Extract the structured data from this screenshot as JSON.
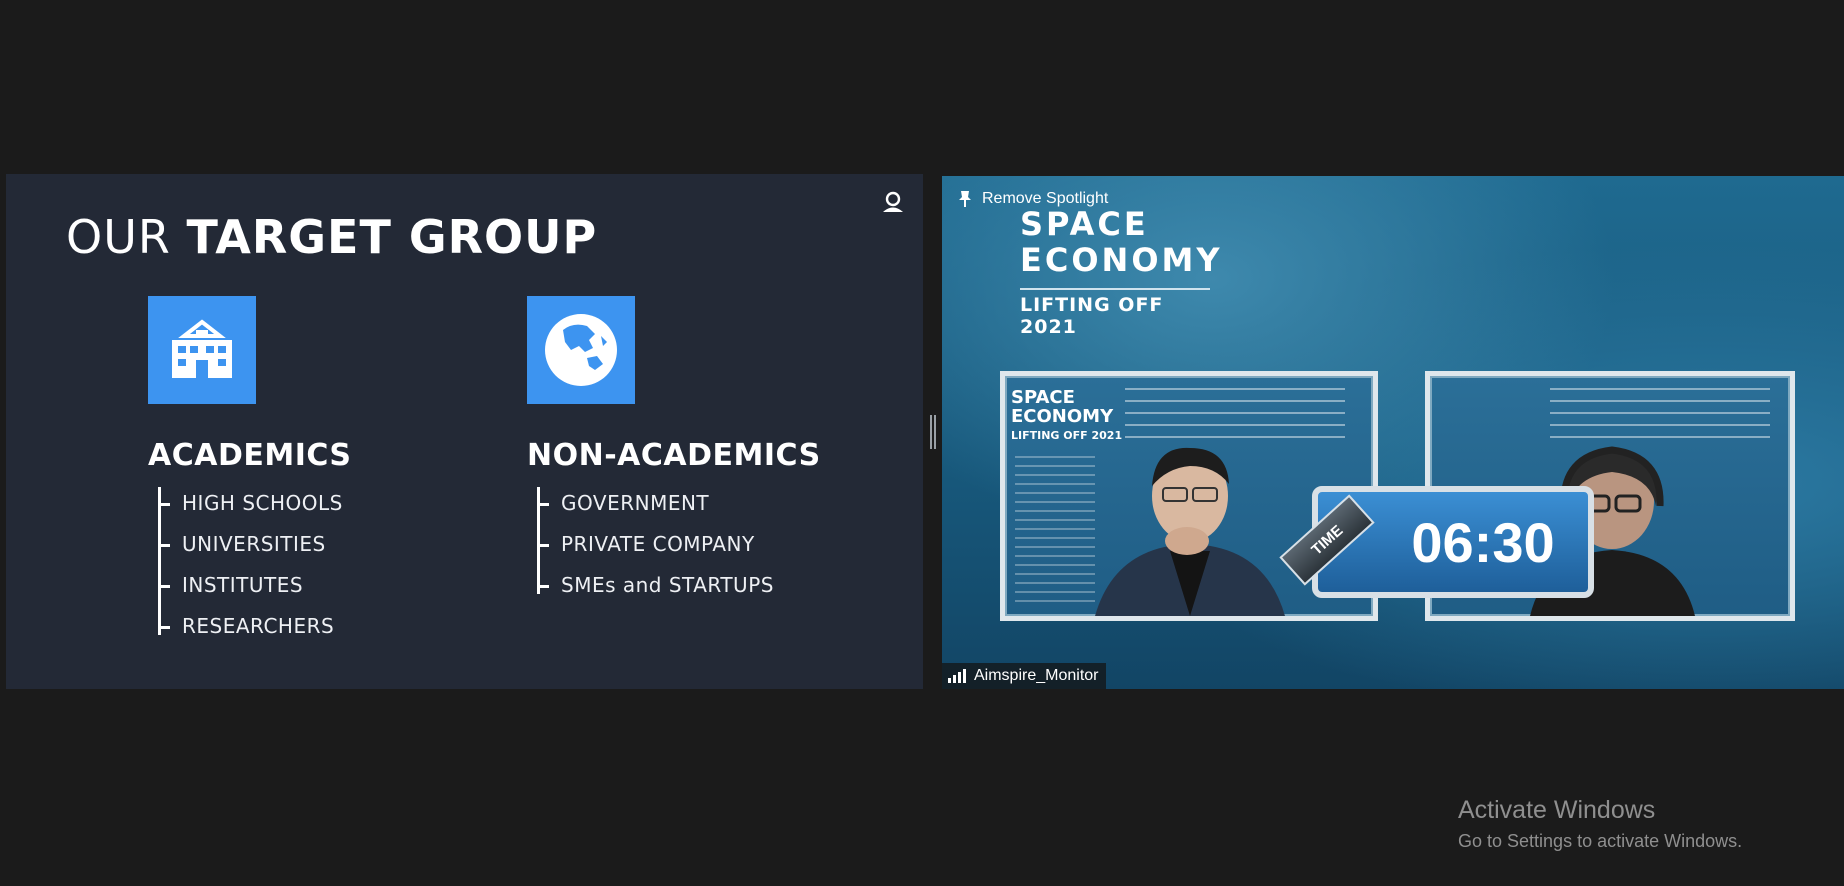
{
  "slide": {
    "title_light": "OUR ",
    "title_bold": "TARGET GROUP",
    "groups": [
      {
        "icon": "school-building-icon",
        "heading": "ACADEMICS",
        "items": [
          "HIGH SCHOOLS",
          "UNIVERSITIES",
          "INSTITUTES",
          "RESEARCHERS"
        ]
      },
      {
        "icon": "globe-icon",
        "heading": "NON-ACADEMICS",
        "items": [
          "GOVERNMENT",
          "PRIVATE COMPANY",
          "SMEs and STARTUPS"
        ]
      }
    ],
    "accent_color": "#3d94f0"
  },
  "video": {
    "remove_spotlight_label": "Remove Spotlight",
    "event_logo": {
      "line1": "SPACE",
      "line2": "ECONOMY",
      "line3": "LIFTING OFF 2021"
    },
    "cam_logo": {
      "line1": "SPACE",
      "line2": "ECONOMY",
      "line3": "LIFTING OFF 2021"
    },
    "timer": {
      "tag": "TIME",
      "value": "06:30"
    },
    "participant_name": "Aimspire_Monitor"
  },
  "watermark": {
    "title": "Activate Windows",
    "subtitle": "Go to Settings to activate Windows."
  }
}
